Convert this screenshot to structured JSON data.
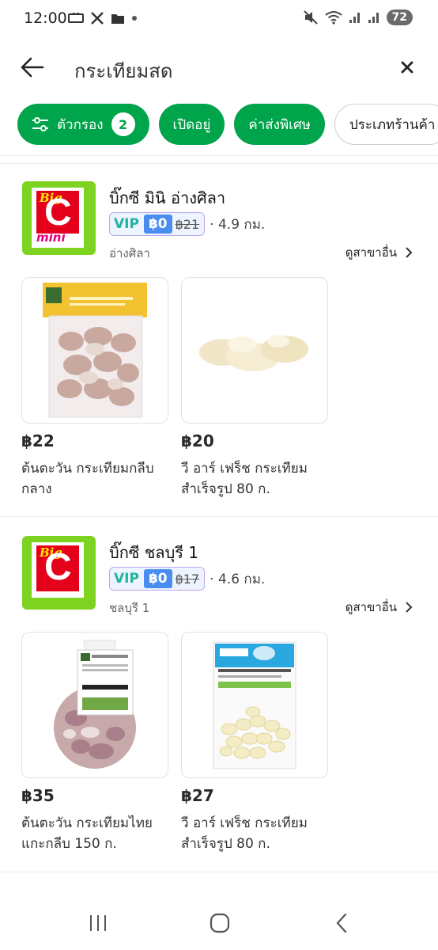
{
  "status": {
    "time": "12:00",
    "battery": "72"
  },
  "search": {
    "query": "กระเทียมสด"
  },
  "filters": [
    {
      "label": "ตัวกรอง",
      "count": "2"
    },
    {
      "label": "เปิดอยู่"
    },
    {
      "label": "ค่าส่งพิเศษ"
    },
    {
      "label": "ประเภทร้านค้า"
    }
  ],
  "stores": [
    {
      "name": "บิ๊กซี มินิ อ่างศิลา",
      "vip": "VIP",
      "fee": "฿0",
      "old_fee": "฿21",
      "distance": "· 4.9 กม.",
      "branch": "อ่างศิลา",
      "see_more": "ดูสาขาอื่น",
      "logo_text_top": "Big",
      "logo_text_c": "C",
      "logo_text_mini": "mini",
      "products": [
        {
          "price": "฿22",
          "name": "ต้นตะวัน กระเทียมกลีบกลาง"
        },
        {
          "price": "฿20",
          "name": "วี อาร์ เฟร็ช กระเทียม สำเร็จรูป 80 ก."
        }
      ]
    },
    {
      "name": "บิ๊กซี ชลบุรี 1",
      "vip": "VIP",
      "fee": "฿0",
      "old_fee": "฿17",
      "distance": "· 4.6 กม.",
      "branch": "ชลบุรี 1",
      "see_more": "ดูสาขาอื่น",
      "logo_text_top": "Big",
      "logo_text_c": "C",
      "products": [
        {
          "price": "฿35",
          "name": "ต้นตะวัน กระเทียมไทย แกะกลีบ 150 ก."
        },
        {
          "price": "฿27",
          "name": "วี อาร์ เฟร็ช กระเทียม สำเร็จรูป 80 ก."
        }
      ]
    }
  ],
  "colors": {
    "accent": "#00a44a",
    "logo_bg": "#7ed321",
    "logo_red": "#e4001b"
  },
  "icons": [
    "back-arrow-icon",
    "close-icon",
    "filter-icon",
    "chevron-right-icon",
    "recents-icon",
    "home-icon",
    "back-icon"
  ]
}
